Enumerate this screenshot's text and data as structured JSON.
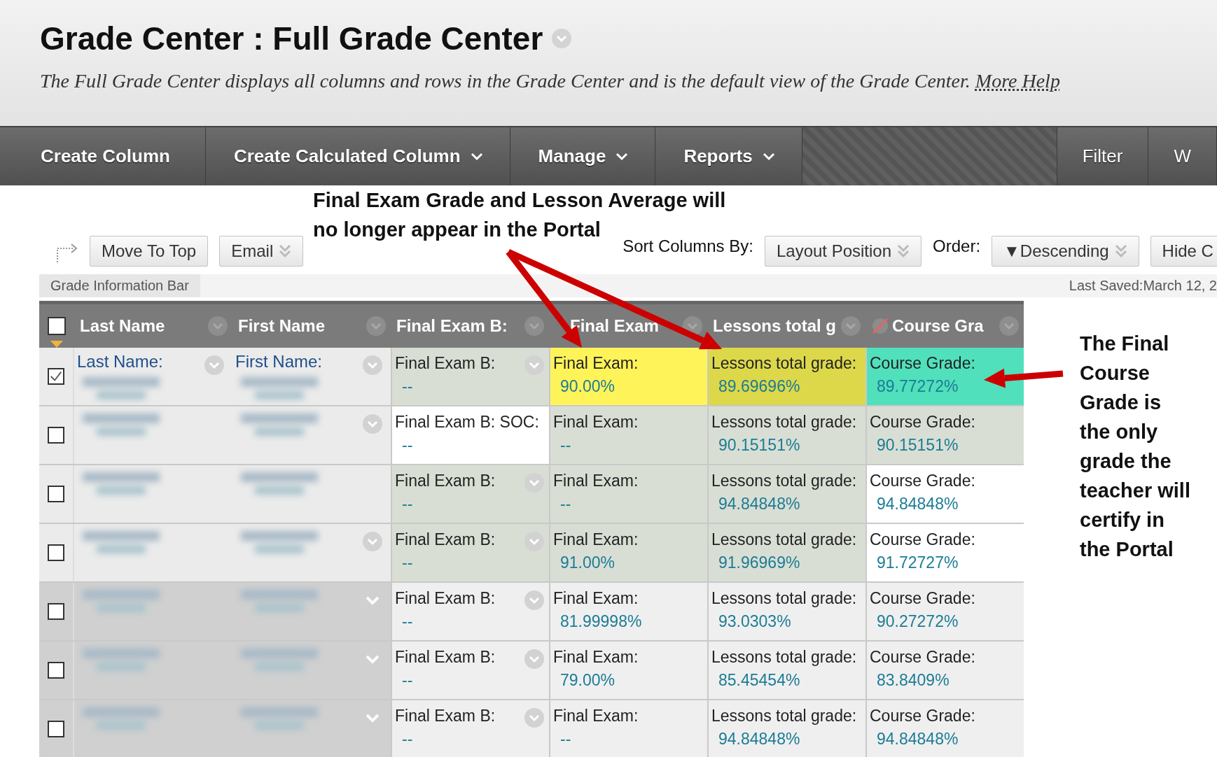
{
  "header": {
    "title": "Grade Center : Full Grade Center",
    "description": "The Full Grade Center displays all columns and rows in the Grade Center and is the default view of the Grade Center.",
    "help_link": "More Help"
  },
  "nav": {
    "left": [
      {
        "label": "Create Column",
        "dropdown": false
      },
      {
        "label": "Create Calculated Column",
        "dropdown": true
      },
      {
        "label": "Manage",
        "dropdown": true
      },
      {
        "label": "Reports",
        "dropdown": true
      }
    ],
    "right": [
      {
        "label": "Filter",
        "dropdown": false
      },
      {
        "label": "W",
        "dropdown": false
      }
    ]
  },
  "callouts": {
    "top": "Final Exam Grade and Lesson Average will no longer appear in the Portal",
    "right": "The Final Course Grade is the only grade the teacher will certify in the Portal"
  },
  "toolbar": {
    "buttons": [
      {
        "label": "Move To Top",
        "dropdown": false
      },
      {
        "label": "Email",
        "dropdown": true
      }
    ],
    "sort_label": "Sort Columns By:",
    "sort_value": "Layout Position",
    "order_label": "Order:",
    "order_value": "▼Descending",
    "hide": "Hide C"
  },
  "info_bar": {
    "label": "Grade Information Bar",
    "last_saved": "Last Saved:March 12, 2"
  },
  "table": {
    "select_all_checked": false,
    "columns": [
      {
        "label": "Last Name"
      },
      {
        "label": "First Name"
      },
      {
        "label": "Final Exam B:"
      },
      {
        "label": "Final Exam"
      },
      {
        "label": "Lessons total g"
      },
      {
        "label": "Course Gra"
      }
    ],
    "rows": [
      {
        "checked": true,
        "kind": "plain",
        "cells": [
          {
            "kind": "name",
            "label": "Last Name:",
            "menu": true
          },
          {
            "kind": "name",
            "label": "First Name:",
            "menu": true
          },
          {
            "kind": "grade",
            "label": "Final Exam B:",
            "value": "--",
            "color": "#d9ded4",
            "menu": true
          },
          {
            "kind": "grade",
            "label": "Final Exam:",
            "value": "90.00%",
            "color": "#fff35a",
            "menu": false
          },
          {
            "kind": "grade",
            "label": "Lessons total grade:",
            "value": "89.69696%",
            "color": "#dcd84a",
            "menu": false
          },
          {
            "kind": "grade",
            "label": "Course Grade:",
            "value": "89.77272%",
            "color": "#50e0bc",
            "menu": false
          }
        ]
      },
      {
        "checked": false,
        "kind": "plain",
        "cells": [
          {
            "kind": "name",
            "menu": false
          },
          {
            "kind": "name",
            "menu": true
          },
          {
            "kind": "grade",
            "label": "Final Exam B: SOC:",
            "value": "--",
            "color": "#ffffff",
            "menu": false
          },
          {
            "kind": "grade",
            "label": "Final Exam:",
            "value": "--",
            "color": "#d9ded4",
            "menu": false
          },
          {
            "kind": "grade",
            "label": "Lessons total grade:",
            "value": "90.15151%",
            "color": "#d9ded4",
            "menu": false
          },
          {
            "kind": "grade",
            "label": "Course Grade:",
            "value": "90.15151%",
            "color": "#d9ded4",
            "menu": false
          }
        ]
      },
      {
        "checked": false,
        "kind": "plain",
        "cells": [
          {
            "kind": "name",
            "menu": false
          },
          {
            "kind": "name",
            "menu": false
          },
          {
            "kind": "grade",
            "label": "Final Exam B:",
            "value": "--",
            "color": "#d9ded4",
            "menu": true
          },
          {
            "kind": "grade",
            "label": "Final Exam:",
            "value": "--",
            "color": "#d9ded4",
            "menu": false
          },
          {
            "kind": "grade",
            "label": "Lessons total grade:",
            "value": "94.84848%",
            "color": "#d9ded4",
            "menu": false
          },
          {
            "kind": "grade",
            "label": "Course Grade:",
            "value": "94.84848%",
            "color": "#ffffff",
            "menu": false
          }
        ]
      },
      {
        "checked": false,
        "kind": "plain",
        "cells": [
          {
            "kind": "name",
            "menu": false
          },
          {
            "kind": "name",
            "menu": true
          },
          {
            "kind": "grade",
            "label": "Final Exam B:",
            "value": "--",
            "color": "#d9ded4",
            "menu": true
          },
          {
            "kind": "grade",
            "label": "Final Exam:",
            "value": "91.00%",
            "color": "#d9ded4",
            "menu": false
          },
          {
            "kind": "grade",
            "label": "Lessons total grade:",
            "value": "91.96969%",
            "color": "#d9ded4",
            "menu": false
          },
          {
            "kind": "grade",
            "label": "Course Grade:",
            "value": "91.72727%",
            "color": "#ffffff",
            "menu": false
          }
        ]
      },
      {
        "checked": false,
        "kind": "shaded",
        "cells": [
          {
            "kind": "name",
            "menu": false
          },
          {
            "kind": "name",
            "menu": true
          },
          {
            "kind": "grade",
            "label": "Final Exam B:",
            "value": "--",
            "color": "#efefef",
            "menu": true
          },
          {
            "kind": "grade",
            "label": "Final Exam:",
            "value": "81.99998%",
            "color": "#efefef",
            "menu": false
          },
          {
            "kind": "grade",
            "label": "Lessons total grade:",
            "value": "93.0303%",
            "color": "#efefef",
            "menu": false
          },
          {
            "kind": "grade",
            "label": "Course Grade:",
            "value": "90.27272%",
            "color": "#efefef",
            "menu": false
          }
        ]
      },
      {
        "checked": false,
        "kind": "shaded",
        "cells": [
          {
            "kind": "name",
            "menu": false
          },
          {
            "kind": "name",
            "menu": true
          },
          {
            "kind": "grade",
            "label": "Final Exam B:",
            "value": "--",
            "color": "#efefef",
            "menu": true
          },
          {
            "kind": "grade",
            "label": "Final Exam:",
            "value": "79.00%",
            "color": "#efefef",
            "menu": false
          },
          {
            "kind": "grade",
            "label": "Lessons total grade:",
            "value": "85.45454%",
            "color": "#efefef",
            "menu": false
          },
          {
            "kind": "grade",
            "label": "Course Grade:",
            "value": "83.8409%",
            "color": "#efefef",
            "menu": false
          }
        ]
      },
      {
        "checked": false,
        "kind": "shaded",
        "cells": [
          {
            "kind": "name",
            "menu": false
          },
          {
            "kind": "name",
            "menu": true
          },
          {
            "kind": "grade",
            "label": "Final Exam B:",
            "value": "--",
            "color": "#efefef",
            "menu": true
          },
          {
            "kind": "grade",
            "label": "Final Exam:",
            "value": "--",
            "color": "#efefef",
            "menu": false
          },
          {
            "kind": "grade",
            "label": "Lessons total grade:",
            "value": "94.84848%",
            "color": "#efefef",
            "menu": false
          },
          {
            "kind": "grade",
            "label": "Course Grade:",
            "value": "94.84848%",
            "color": "#efefef",
            "menu": false
          }
        ]
      }
    ]
  }
}
